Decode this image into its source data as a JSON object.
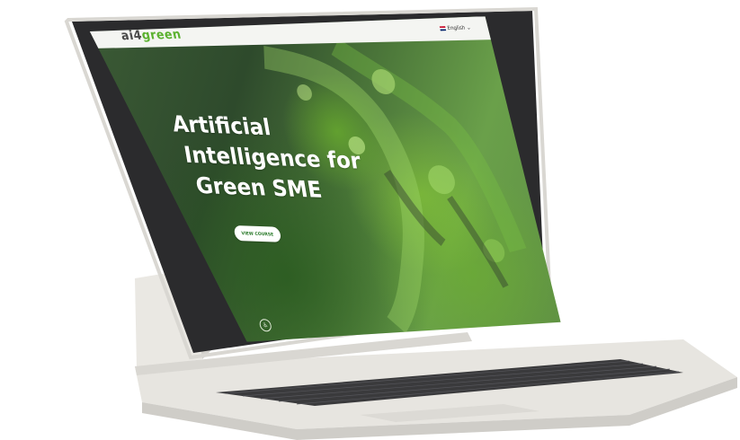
{
  "nav": {
    "logo_ai": "ai4",
    "logo_green": "green",
    "language": "English",
    "language_chevron": "⌄"
  },
  "hero": {
    "title_line1": "Artificial",
    "title_line2": "Intelligence for",
    "title_line3": "Green SME",
    "cta_label": "VIEW COURSE"
  },
  "icons": {
    "flag": "uk-flag-icon",
    "accessibility": "accessibility-icon",
    "chevron": "chevron-down-icon"
  },
  "colors": {
    "brand_green": "#5bb12f",
    "device_body": "#e6e4df",
    "keyboard_keys": "#3a3a3c"
  }
}
